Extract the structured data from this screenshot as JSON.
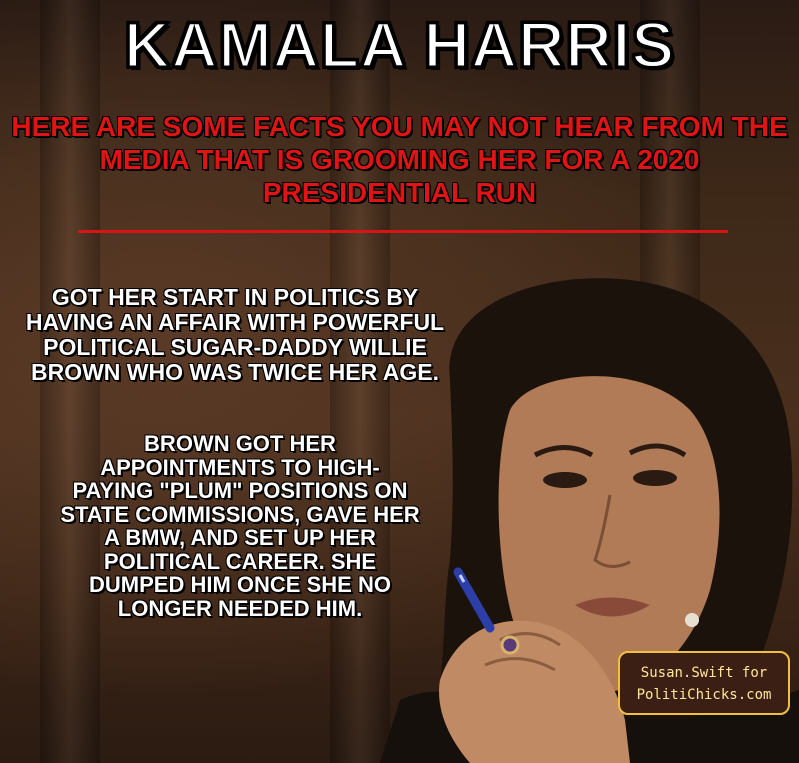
{
  "title": "KAMALA HARRIS",
  "subtitle": "HERE ARE SOME FACTS YOU MAY NOT HEAR FROM THE MEDIA THAT IS GROOMING HER FOR A 2020 PRESIDENTIAL RUN",
  "fact_1": "GOT HER START IN POLITICS BY HAVING AN AFFAIR WITH POWERFUL POLITICAL SUGAR-DADDY WILLIE BROWN WHO WAS TWICE HER AGE.",
  "fact_2": "BROWN GOT HER APPOINTMENTS TO HIGH-PAYING \"PLUM\" POSITIONS ON STATE COMMISSIONS, GAVE HER A BMW, AND SET UP HER POLITICAL CAREER. SHE DUMPED HIM ONCE SHE NO LONGER NEEDED HIM.",
  "credit": {
    "line1": "Susan.Swift for",
    "line2": "PolitiChicks.com"
  },
  "colors": {
    "title": "#ffffff",
    "subtitle": "#e01414",
    "divider": "#d81414",
    "credit_border": "#f0c040",
    "credit_text": "#ffe79a"
  }
}
